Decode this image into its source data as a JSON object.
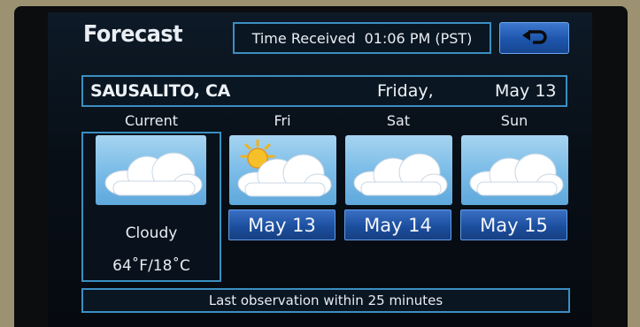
{
  "header": {
    "title": "Forecast",
    "time_received_label": "Time Received",
    "time_received_value": "01:06 PM (PST)"
  },
  "location": {
    "city": "SAUSALITO, CA",
    "day": "Friday,",
    "date": "May 13"
  },
  "current": {
    "label": "Current",
    "icon": "cloud-icon",
    "condition": "Cloudy",
    "temperature": "64˚F/18˚C"
  },
  "forecast": [
    {
      "day": "Fri",
      "date": "May 13",
      "icon": "partly-sunny-icon"
    },
    {
      "day": "Sat",
      "date": "May 14",
      "icon": "cloud-icon"
    },
    {
      "day": "Sun",
      "date": "May 15",
      "icon": "cloud-icon"
    }
  ],
  "status": "Last observation within 25 minutes",
  "colors": {
    "accent_border": "#3b8fc2",
    "button_blue": "#1c4f9e",
    "sky_tile": "#7cbde8",
    "sun": "#f2b21c"
  }
}
